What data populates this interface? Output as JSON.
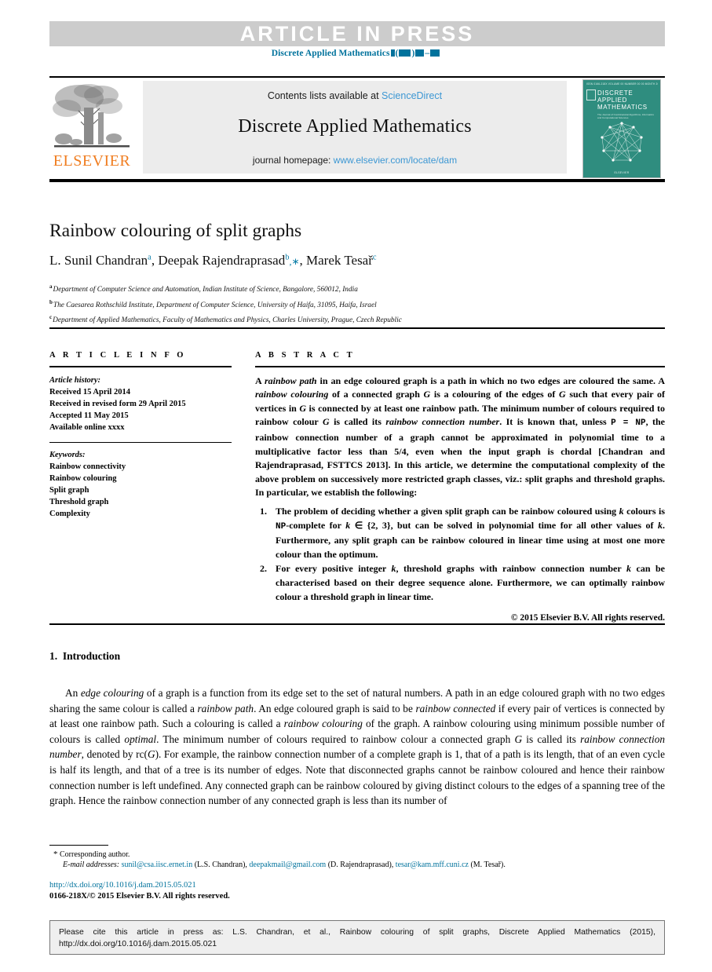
{
  "banner": {
    "text": "ARTICLE IN PRESS",
    "journal_ref_prefix": "Discrete Applied Mathematics",
    "bg_color": "#cccccc",
    "ref_color": "#00729c"
  },
  "masthead": {
    "contents_prefix": "Contents lists available at ",
    "sciencedirect": "ScienceDirect",
    "journal_title": "Discrete Applied Mathematics",
    "homepage_prefix": "journal homepage: ",
    "homepage_url": "www.elsevier.com/locate/dam",
    "publisher": "ELSEVIER",
    "publisher_color": "#f07d20",
    "link_color": "#3c97d3",
    "cover": {
      "header": "ISSN 0166-218X   VOLUME 00   NUMBER 00   00 MONTH 2015",
      "title_line1": "DISCRETE",
      "title_line2": "APPLIED",
      "title_line3": "MATHEMATICS",
      "subtitle": "The Journal of Combinatorial Algorithms, Informatics and Computational Sciences",
      "footer": "ELSEVIER",
      "bg_color": "#2f8d7f"
    }
  },
  "article": {
    "title": "Rainbow colouring of split graphs",
    "authors": [
      {
        "name": "L. Sunil Chandran",
        "mark": "a",
        "corresponding": false
      },
      {
        "name": "Deepak Rajendraprasad",
        "mark": "b",
        "corresponding": true
      },
      {
        "name": "Marek Tesař",
        "mark": "c",
        "corresponding": false
      }
    ],
    "affiliations": [
      {
        "mark": "a",
        "text": "Department of Computer Science and Automation, Indian Institute of Science, Bangalore, 560012, India"
      },
      {
        "mark": "b",
        "text": "The Caesarea Rothschild Institute, Department of Computer Science, University of Haifa, 31095, Haifa, Israel"
      },
      {
        "mark": "c",
        "text": "Department of Applied Mathematics, Faculty of Mathematics and Physics, Charles University, Prague, Czech Republic"
      }
    ]
  },
  "article_info": {
    "heading": "A R T I C L E   I N F O",
    "history_label": "Article history:",
    "history": [
      "Received 15 April 2014",
      "Received in revised form 29 April 2015",
      "Accepted 11 May 2015",
      "Available online xxxx"
    ],
    "keywords_label": "Keywords:",
    "keywords": [
      "Rainbow connectivity",
      "Rainbow colouring",
      "Split graph",
      "Threshold graph",
      "Complexity"
    ]
  },
  "abstract": {
    "heading": "A B S T R A C T",
    "paragraph_html": "A <i>rainbow path</i> in an edge coloured graph is a path in which no two edges are coloured the same. A <i>rainbow colouring</i> of a connected graph <i>G</i> is a colouring of the edges of <i>G</i> such that every pair of vertices in <i>G</i> is connected by at least one rainbow path. The minimum number of colours required to rainbow colour <i>G</i> is called its <i>rainbow connection number</i>. It is known that, unless <span class=\"mono-np\">P = NP</span>, the rainbow connection number of a graph cannot be approximated in polynomial time to a multiplicative factor less than 5/4, even when the input graph is chordal [Chandran and Rajendraprasad, FSTTCS 2013]. In this article, we determine the computational complexity of the above problem on successively more restricted graph classes, viz.: split graphs and threshold graphs. In particular, we establish the following:",
    "items": [
      {
        "number": "1.",
        "html": "The problem of deciding whether a given split graph can be rainbow coloured using <i>k</i> colours is <span class=\"mono-np\">NP</span>-complete for <i>k</i> &isin; {2, 3}, but can be solved in polynomial time for all other values of <i>k</i>. Furthermore, any split graph can be rainbow coloured in linear time using at most one more colour than the optimum."
      },
      {
        "number": "2.",
        "html": "For every positive integer <i>k</i>, threshold graphs with rainbow connection number <i>k</i> can be characterised based on their degree sequence alone. Furthermore, we can optimally rainbow colour a threshold graph in linear time."
      }
    ],
    "copyright": "© 2015 Elsevier B.V. All rights reserved."
  },
  "body": {
    "section_number": "1.",
    "section_title": "Introduction",
    "paragraph_html": "An <i>edge colouring</i> of a graph is a function from its edge set to the set of natural numbers. A path in an edge coloured graph with no two edges sharing the same colour is called a <i>rainbow path</i>. An edge coloured graph is said to be <i>rainbow connected</i> if every pair of vertices is connected by at least one rainbow path. Such a colouring is called a <i>rainbow colouring</i> of the graph. A rainbow colouring using minimum possible number of colours is called <i>optimal</i>. The minimum number of colours required to rainbow colour a connected graph <i>G</i> is called its <i>rainbow connection number</i>, denoted by rc(<i>G</i>). For example, the rainbow connection number of a complete graph is 1, that of a path is its length, that of an even cycle is half its length, and that of a tree is its number of edges. Note that disconnected graphs cannot be rainbow coloured and hence their rainbow connection number is left undefined. Any connected graph can be rainbow coloured by giving distinct colours to the edges of a spanning tree of the graph. Hence the rainbow connection number of any connected graph is less than its number of"
  },
  "footnote": {
    "corresponding_star": "*",
    "corresponding_text": "Corresponding author.",
    "email_label": "E-mail addresses:",
    "emails": [
      {
        "address": "sunil@csa.iisc.ernet.in",
        "person": "(L.S. Chandran),"
      },
      {
        "address": "deepakmail@gmail.com",
        "person": "(D. Rajendraprasad),"
      },
      {
        "address": "tesar@kam.mff.cuni.cz",
        "person": "(M. Tesař)."
      }
    ],
    "doi": "http://dx.doi.org/10.1016/j.dam.2015.05.021",
    "issn_line": "0166-218X/© 2015 Elsevier B.V. All rights reserved.",
    "link_color": "#00729c"
  },
  "cite_box": {
    "line1": "Please cite this article in press as: L.S. Chandran, et al., Rainbow colouring of split graphs, Discrete Applied Mathematics (2015),",
    "line2": "http://dx.doi.org/10.1016/j.dam.2015.05.021",
    "bg_color": "#efefef"
  }
}
